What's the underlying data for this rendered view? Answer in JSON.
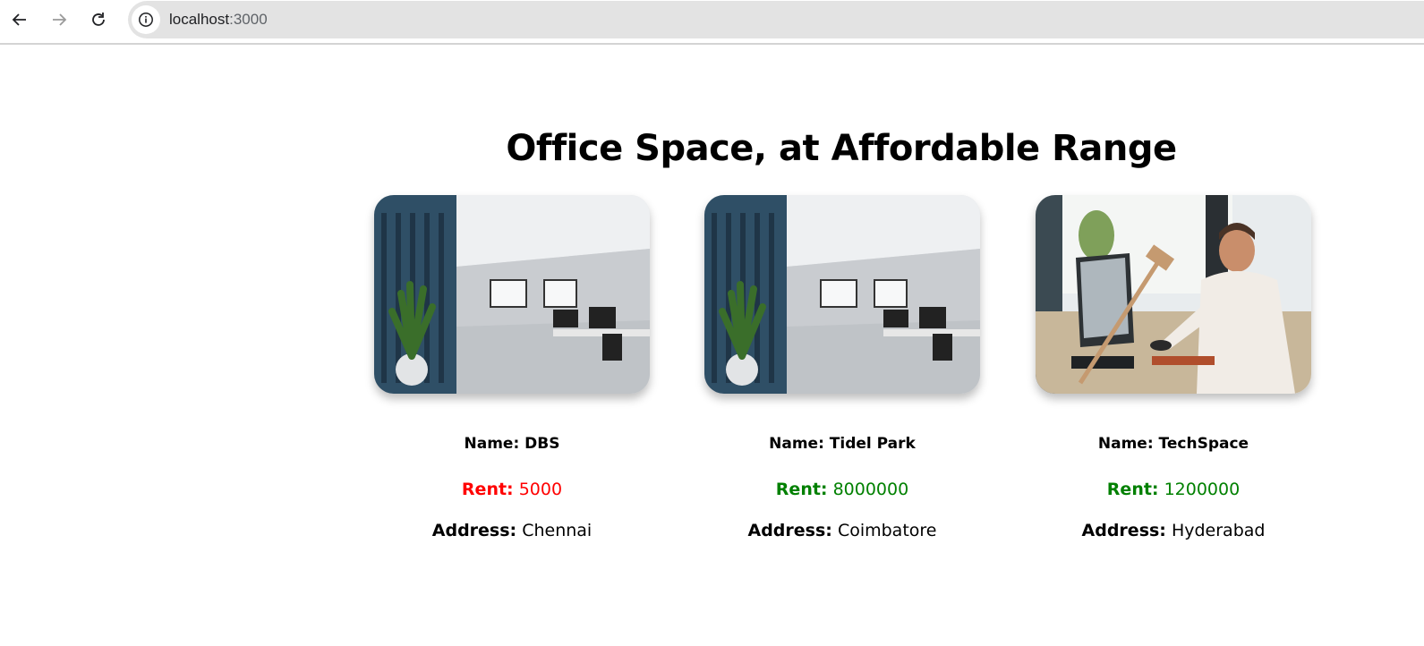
{
  "browser": {
    "url_host": "localhost",
    "url_port": ":3000",
    "back_icon": "arrow-left-icon",
    "forward_icon": "arrow-right-icon",
    "reload_icon": "reload-icon",
    "info_icon": "info-icon"
  },
  "page": {
    "title": "Office Space, at Affordable Range"
  },
  "colors": {
    "low_rent": "#ff0000",
    "high_rent": "#008000"
  },
  "offices": [
    {
      "name_label": "Name: DBS",
      "rent_label": "Rent:",
      "rent_value": "5000",
      "address_label": "Address:",
      "address_value": "Chennai",
      "rent_color": "#ff0000",
      "image": "office-interior-photo"
    },
    {
      "name_label": "Name: Tidel Park",
      "rent_label": "Rent:",
      "rent_value": "8000000",
      "address_label": "Address:",
      "address_value": "Coimbatore",
      "rent_color": "#008000",
      "image": "office-interior-photo"
    },
    {
      "name_label": "Name: TechSpace",
      "rent_label": "Rent:",
      "rent_value": "1200000",
      "address_label": "Address:",
      "address_value": "Hyderabad",
      "rent_color": "#008000",
      "image": "man-at-computer-photo"
    }
  ]
}
